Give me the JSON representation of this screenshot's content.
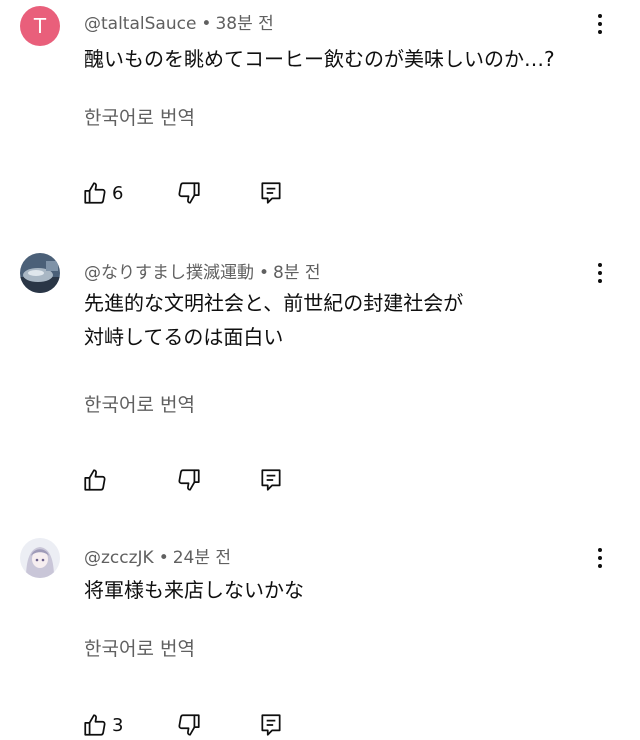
{
  "comments": [
    {
      "handle": "@taltalSauce",
      "separator": "•",
      "time": "38분 전",
      "avatar_letter": "T",
      "avatar_color": "#e95f7b",
      "text_lines": [
        "醜いものを眺めてコーヒー飲むのが美味しいのか…?"
      ],
      "translate_label": "한국어로 번역",
      "like_count": "6"
    },
    {
      "handle": "@なりすまし撲滅運動",
      "separator": "•",
      "time": "8분 전",
      "avatar_letter": "",
      "text_lines": [
        "先進的な文明社会と、前世紀の封建社会が",
        "対峙してるのは面白い"
      ],
      "translate_label": "한국어로 번역",
      "like_count": ""
    },
    {
      "handle": "@zcczJK",
      "separator": "•",
      "time": "24분 전",
      "avatar_letter": "",
      "text_lines": [
        "将軍様も来店しないかな"
      ],
      "translate_label": "한국어로 번역",
      "like_count": "3"
    }
  ],
  "icons": {
    "like": "thumbs-up-icon",
    "dislike": "thumbs-down-icon",
    "reply": "reply-icon",
    "more": "more-vert-icon"
  },
  "colors": {
    "secondary_text": "#606060",
    "primary_text": "#0f0f0f"
  }
}
